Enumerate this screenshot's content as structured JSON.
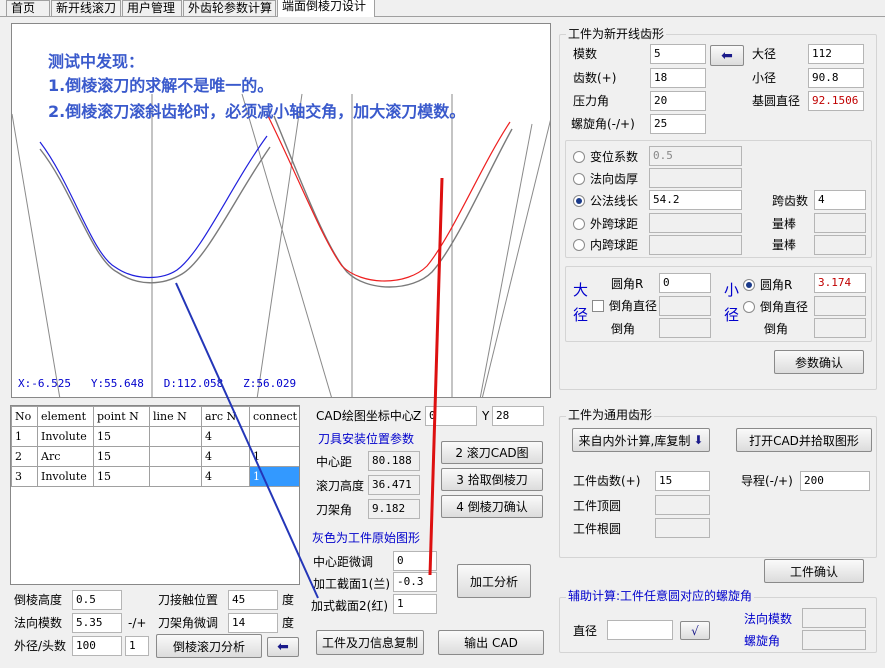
{
  "tabs": [
    "首页",
    "新开线滚刀",
    "用户管理",
    "外齿轮参数计算",
    "端面倒棱刀设计"
  ],
  "canvas": {
    "notes": [
      "测试中发现：",
      "1.倒棱滚刀的求解不是唯一的。",
      "2.倒棱滚刀滚斜齿轮时，必须减小轴交角，加大滚刀模数。"
    ],
    "status": "X:-6.525   Y:55.648   D:112.058   Z:56.029",
    "colors": {
      "blue_curve": "#2020dd",
      "red_curve": "#ee2020",
      "gray_curve": "#7a7a7a",
      "line": "#2436b8",
      "red_line": "#dd1010"
    }
  },
  "grid": {
    "columns": [
      "No",
      "element",
      "point N",
      "line N",
      "arc N",
      "connect"
    ],
    "rows": [
      [
        "1",
        "Involute",
        "15",
        "",
        "4",
        ""
      ],
      [
        "2",
        "Arc",
        "15",
        "",
        "4",
        "1"
      ],
      [
        "3",
        "Involute",
        "15",
        "",
        "4",
        "1"
      ]
    ]
  },
  "workpiece": {
    "title": "工件为新开线齿形",
    "modulus_label": "模数",
    "modulus": "5",
    "teeth_label": "齿数(+)",
    "teeth": "18",
    "pressure_label": "压力角",
    "pressure": "20",
    "helix_label": "螺旋角(-/+)",
    "helix": "25",
    "od_label": "大径",
    "od": "112",
    "rd_label": "小径",
    "rd": "90.8",
    "base_label": "基圆直径",
    "base": "92.1506"
  },
  "params": {
    "shift_label": "变位系数",
    "shift": "0.5",
    "normal_thick_label": "法向齿厚",
    "span_label": "公法线长",
    "span": "54.2",
    "span_teeth_label": "跨齿数",
    "span_teeth": "4",
    "outer_ball_label": "外跨球距",
    "ball_label_1": "量棒",
    "inner_ball_label": "内跨球距",
    "ball_label_2": "量棒"
  },
  "corner": {
    "big_label_1": "大",
    "big_label_2": "径",
    "small_label_1": "小",
    "small_label_2": "径",
    "big_r_label": "圆角R",
    "big_r": "0",
    "big_chamfer_label": "倒角直径",
    "big_chamfer2_label": "倒角",
    "small_r_label": "圆角R",
    "small_r": "3.174",
    "small_chamfer_label": "倒角直径",
    "small_chamfer2_label": "倒角",
    "confirm": "参数确认"
  },
  "cad": {
    "center_label": "CAD绘图坐标中心",
    "z_label": "Z",
    "z": "0",
    "y_label": "Y",
    "y": "28",
    "install_title": "刀具安装位置参数",
    "center_dist_label": "中心距",
    "center_dist": "80.188",
    "hob_height_label": "滚刀高度",
    "hob_height": "36.471",
    "rack_angle_label": "刀架角",
    "rack_angle": "9.182",
    "btn2": "2  滚刀CAD图",
    "btn3": "3 拾取倒棱刀",
    "btn4": "4 倒棱刀确认",
    "gray_title": "灰色为工件原始图形",
    "micro_label": "中心距微调",
    "micro": "0",
    "sec1_label": "加工截面1(兰)",
    "sec1": "-0.3",
    "sec2_label": "加式截面2(红)",
    "sec2": "1",
    "analyze": "加工分析"
  },
  "bottom": {
    "chamfer_h_label": "倒棱高度",
    "chamfer_h": "0.5",
    "tool_pos_label": "刀接触位置",
    "tool_pos": "45",
    "deg1": "度",
    "normal_mod_label": "法向模数",
    "normal_mod": "5.35",
    "pm": "-/+",
    "rack_micro_label": "刀架角微调",
    "rack_micro": "14",
    "deg2": "度",
    "od_heads_label": "外径/头数",
    "od_val": "100",
    "heads": "1",
    "analyze_btn": "倒棱滚刀分析",
    "copy_btn": "工件及刀信息复制",
    "export_btn": "输出 CAD"
  },
  "general": {
    "title": "工件为通用齿形",
    "copy_btn": "来自内外计算,库复制",
    "open_btn": "打开CAD并拾取图形",
    "teeth_label": "工件齿数(+)",
    "teeth": "15",
    "lead_label": "导程(-/+)",
    "lead": "200",
    "tip_label": "工件顶圆",
    "root_label": "工件根圆",
    "confirm": "工件确认"
  },
  "aux": {
    "title": "辅助计算:工件任意圆对应的螺旋角",
    "dia_label": "直径",
    "normal_mod_label": "法向模数",
    "helix_label": "螺旋角"
  }
}
